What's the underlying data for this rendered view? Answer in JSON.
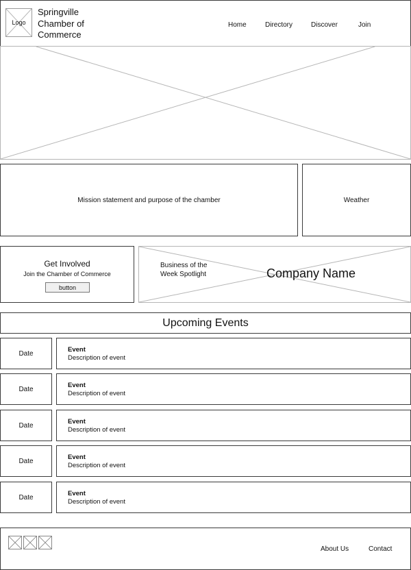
{
  "header": {
    "logo_label": "Logo",
    "site_title": "Springville Chamber of Commerce",
    "nav": [
      {
        "label": "Home"
      },
      {
        "label": "Directory"
      },
      {
        "label": "Discover"
      },
      {
        "label": "Join"
      }
    ]
  },
  "mission": {
    "text": "Mission statement and purpose of the chamber"
  },
  "weather": {
    "label": "Weather"
  },
  "get_involved": {
    "title": "Get Involved",
    "subtitle": "Join the Chamber of Commerce",
    "button_label": "button"
  },
  "spotlight": {
    "label": "Business of the Week Spotlight",
    "company_name": "Company Name"
  },
  "events": {
    "heading": "Upcoming Events",
    "items": [
      {
        "date": "Date",
        "title": "Event",
        "description": "Description of event"
      },
      {
        "date": "Date",
        "title": "Event",
        "description": "Description of event"
      },
      {
        "date": "Date",
        "title": "Event",
        "description": "Description of event"
      },
      {
        "date": "Date",
        "title": "Event",
        "description": "Description of event"
      },
      {
        "date": "Date",
        "title": "Event",
        "description": "Description of event"
      }
    ]
  },
  "footer": {
    "social_icons": [
      "social-icon-placeholder",
      "social-icon-placeholder",
      "social-icon-placeholder"
    ],
    "links": [
      {
        "label": "About Us"
      },
      {
        "label": "Contact"
      }
    ]
  }
}
